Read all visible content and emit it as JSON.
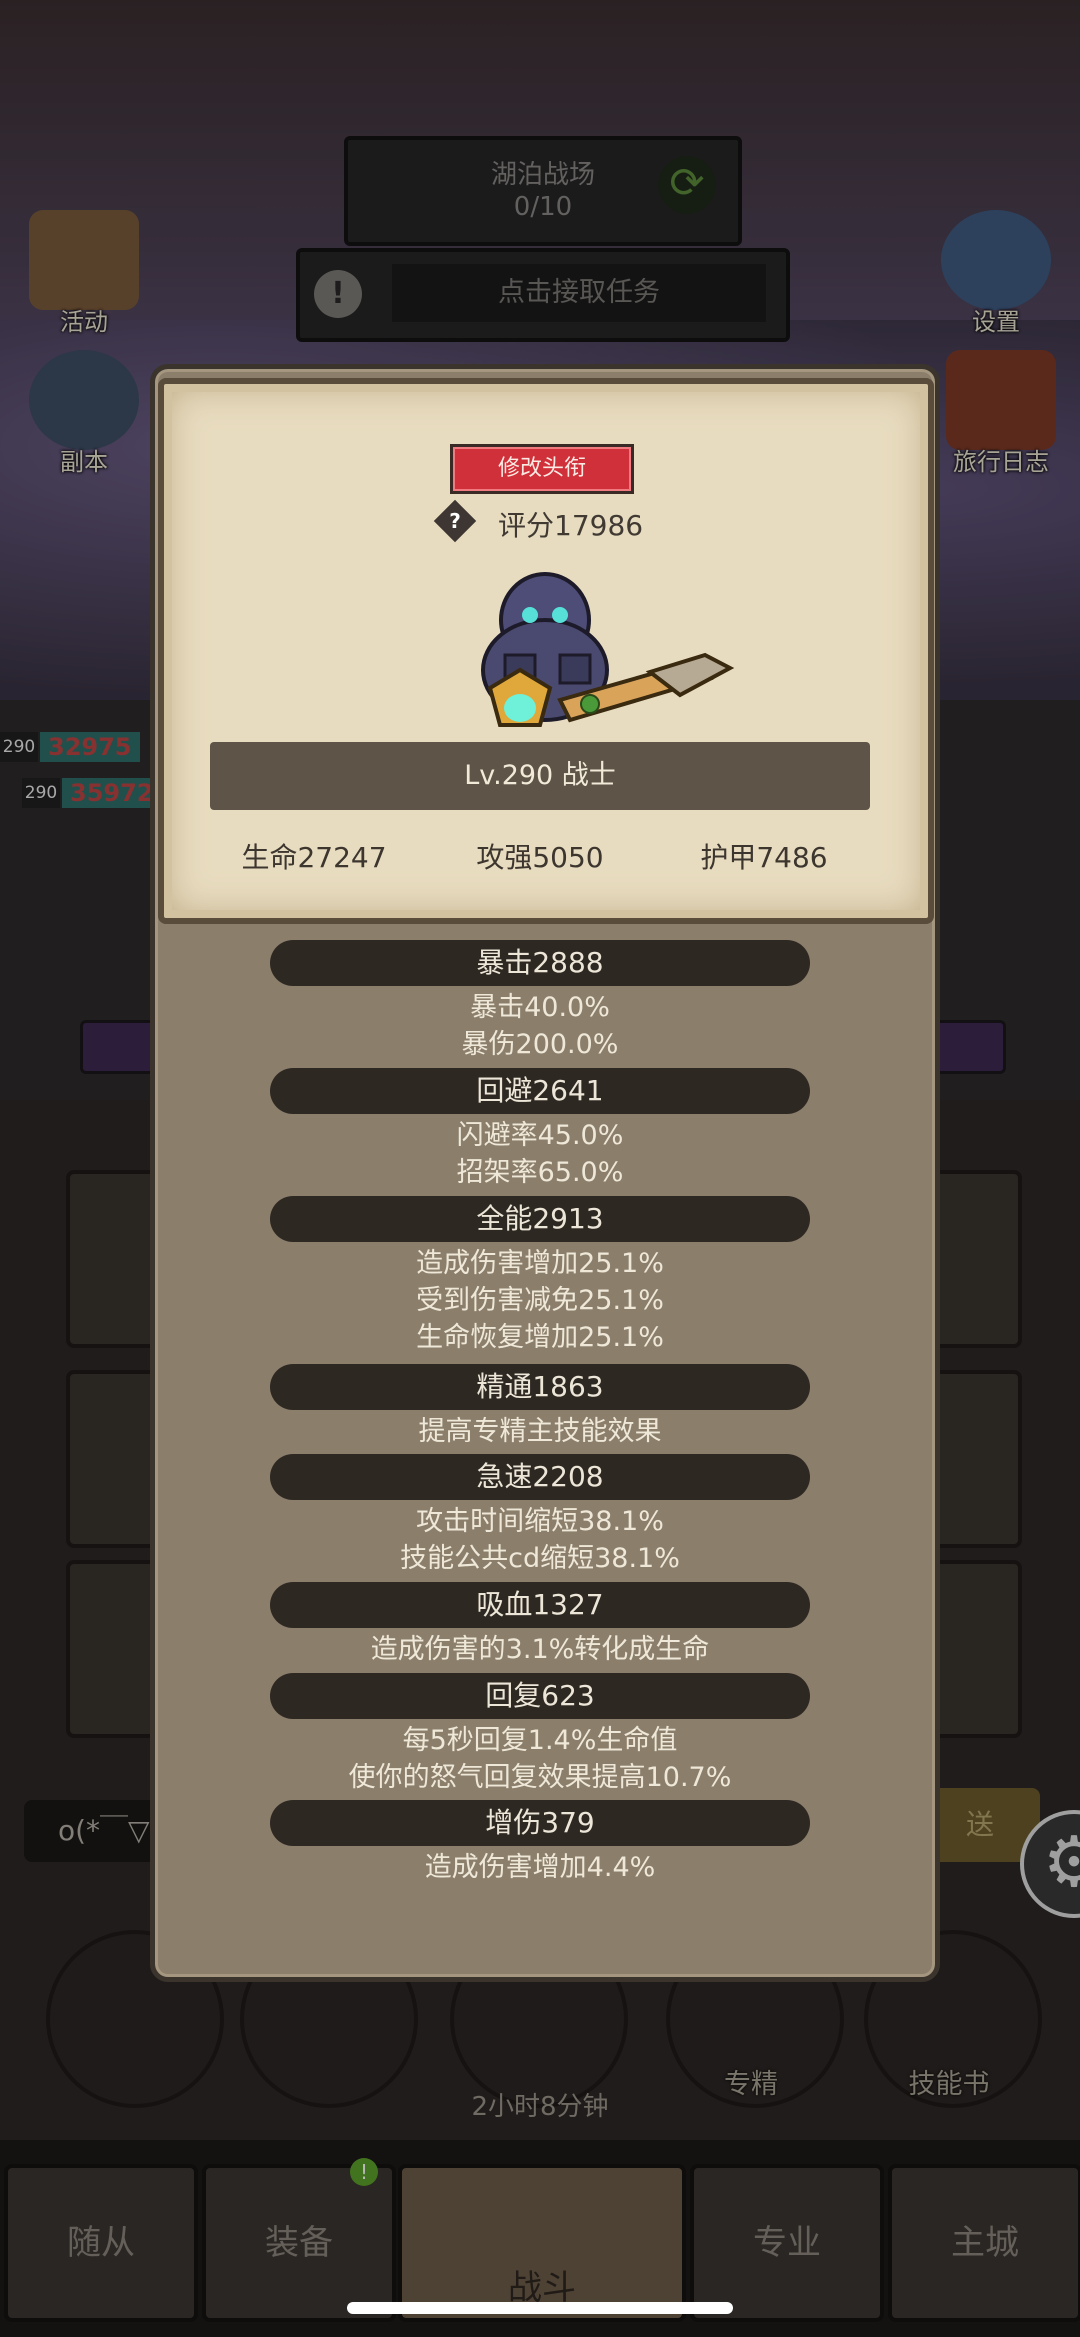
{
  "quest": {
    "title": "湖泊战场",
    "progress": "0/10",
    "task_prompt": "点击接取任务"
  },
  "side_icons": {
    "events": "活动",
    "dungeon": "副本",
    "settings": "设置",
    "journal": "旅行日志"
  },
  "enemies": [
    {
      "level": "290",
      "hp": "32975"
    },
    {
      "level": "290",
      "hp": "35972"
    }
  ],
  "hero_card": {
    "change_title_button": "修改头衔",
    "score": "评分17986",
    "level_class": "Lv.290 战士",
    "hp": "生命27247",
    "attack": "攻强5050",
    "armor": "护甲7486"
  },
  "attributes": [
    {
      "header": "暴击2888",
      "lines": [
        "暴击40.0%",
        "暴伤200.0%"
      ]
    },
    {
      "header": "回避2641",
      "lines": [
        "闪避率45.0%",
        "招架率65.0%"
      ]
    },
    {
      "header": "全能2913",
      "lines": [
        "造成伤害增加25.1%",
        "受到伤害减免25.1%",
        "生命恢复增加25.1%"
      ]
    },
    {
      "header": "精通1863",
      "lines": [
        "提高专精主技能效果"
      ]
    },
    {
      "header": "急速2208",
      "lines": [
        "攻击时间缩短38.1%",
        "技能公共cd缩短38.1%"
      ]
    },
    {
      "header": "吸血1327",
      "lines": [
        "造成伤害的3.1%转化成生命"
      ]
    },
    {
      "header": "回复623",
      "lines": [
        "每5秒回复1.4%生命值",
        "使你的怒气回复效果提高10.7%"
      ]
    },
    {
      "header": "增伤379",
      "lines": [
        "造成伤害增加4.4%"
      ]
    }
  ],
  "chat": {
    "preview": "o(*￣▽",
    "send": "送"
  },
  "action_orbs": {
    "specialization": "专精",
    "skill_book": "技能书",
    "timer": "2小时8分钟"
  },
  "bottom_nav": {
    "followers": "随从",
    "equipment": "装备",
    "battle": "战斗",
    "profession": "专业",
    "main_city": "主城",
    "equipment_badge": "!"
  },
  "colors": {
    "title_button": "#d0303a",
    "card_bg": "#e8dcc0",
    "panel_bg": "#8b7e6b",
    "attr_pill": "#2e2823"
  }
}
